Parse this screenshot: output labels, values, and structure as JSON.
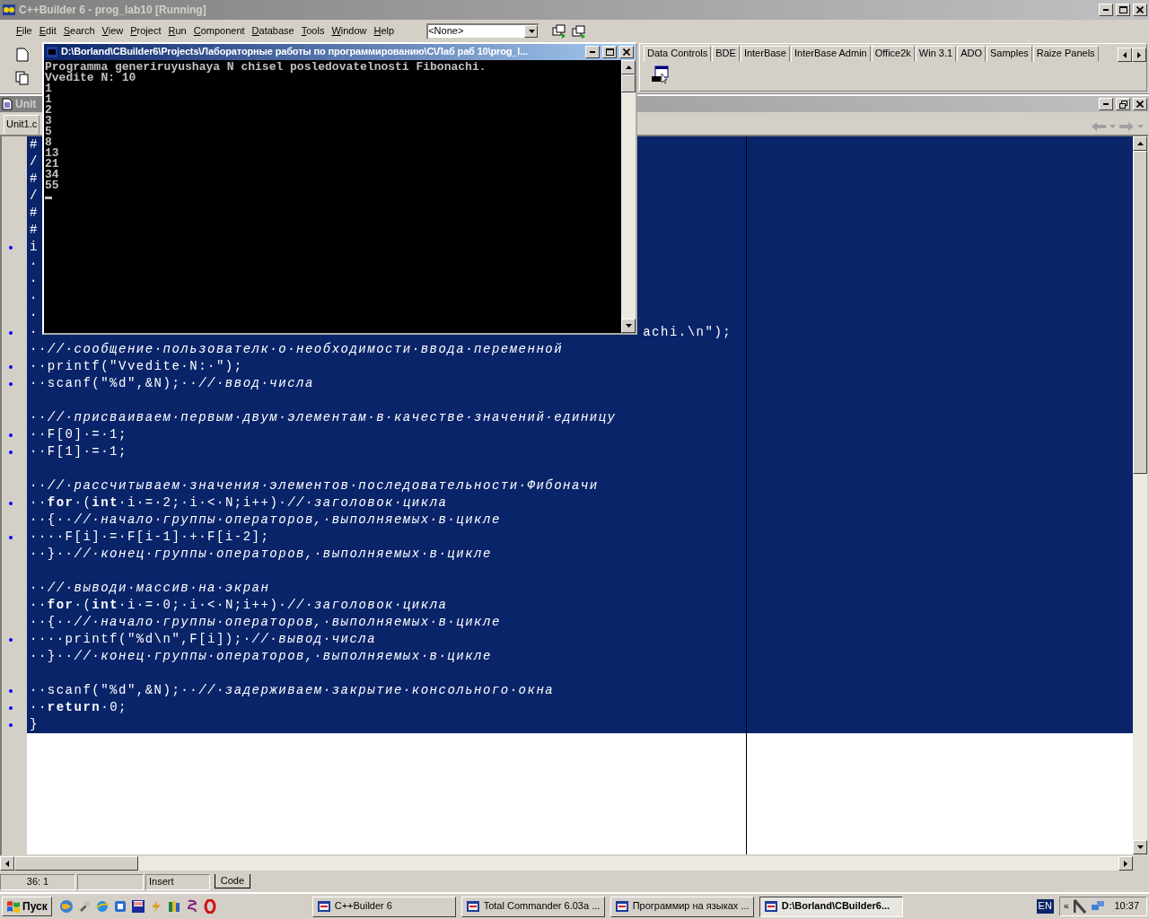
{
  "ide_window": {
    "title": "C++Builder 6 - prog_lab10 [Running]",
    "menu": [
      "File",
      "Edit",
      "Search",
      "View",
      "Project",
      "Run",
      "Component",
      "Database",
      "Tools",
      "Window",
      "Help"
    ],
    "target_combo": {
      "value": "<None>"
    },
    "palette_tabs": [
      "Data Controls",
      "BDE",
      "InterBase",
      "InterBase Admin",
      "Office2k",
      "Win 3.1",
      "ADO",
      "Samples",
      "Raize Panels"
    ]
  },
  "editor_window": {
    "title": "Unit",
    "file_tab": "Unit1.c",
    "code_lines": [
      {
        "kind": "code",
        "text": "#",
        "marker": false
      },
      {
        "kind": "code",
        "text": "/",
        "marker": false
      },
      {
        "kind": "code",
        "text": "#",
        "marker": false
      },
      {
        "kind": "code",
        "text": "/",
        "marker": false
      },
      {
        "kind": "code",
        "text": "#",
        "marker": false
      },
      {
        "kind": "code",
        "text": "#",
        "marker": false
      },
      {
        "kind": "code",
        "text": "i",
        "marker": true
      },
      {
        "kind": "code",
        "text": "·",
        "marker": false
      },
      {
        "kind": "code",
        "text": "·",
        "marker": false
      },
      {
        "kind": "code",
        "text": "·",
        "marker": false
      },
      {
        "kind": "code",
        "text": "·",
        "marker": false
      },
      {
        "kind": "code",
        "text": "·",
        "tail": "achi.\\n\");",
        "marker": true
      },
      {
        "kind": "code",
        "text": "··*//·сообщение·пользователк·о·необходимости·ввода·переменной*",
        "marker": false
      },
      {
        "kind": "code",
        "text": "··printf(\"Vvedite·N:·\");",
        "marker": true
      },
      {
        "kind": "code",
        "text": "··scanf(\"%d\",&N);··*//·ввод·числа*",
        "marker": true
      },
      {
        "kind": "blank"
      },
      {
        "kind": "code",
        "text": "··*//·присваиваем·первым·двум·элементам·в·качестве·значений·единицу*",
        "marker": false
      },
      {
        "kind": "code",
        "text": "··F[0]·=·1;",
        "marker": true
      },
      {
        "kind": "code",
        "text": "··F[1]·=·1;",
        "marker": true
      },
      {
        "kind": "blank"
      },
      {
        "kind": "code",
        "text": "··*//·рассчитываем·значения·элементов·последовательности·Фибоначи*",
        "marker": false
      },
      {
        "kind": "code",
        "text": "··**for**·(**int**·i·=·2;·i·<·N;i++)·*//·заголовок·цикла*",
        "marker": true
      },
      {
        "kind": "code",
        "text": "··{··*//·начало·группы·операторов,·выполняемых·в·цикле*",
        "marker": false
      },
      {
        "kind": "code",
        "text": "····F[i]·=·F[i-1]·+·F[i-2];",
        "marker": true
      },
      {
        "kind": "code",
        "text": "··}··*//·конец·группы·операторов,·выполняемых·в·цикле*",
        "marker": false
      },
      {
        "kind": "blank"
      },
      {
        "kind": "code",
        "text": "··*//·выводи·массив·на·экран*",
        "marker": false
      },
      {
        "kind": "code",
        "text": "··**for**·(**int**·i·=·0;·i·<·N;i++)·*//·заголовок·цикла*",
        "marker": false
      },
      {
        "kind": "code",
        "text": "··{··*//·начало·группы·операторов,·выполняемых·в·цикле*",
        "marker": false
      },
      {
        "kind": "code",
        "text": "····printf(\"%d\\n\",F[i]);·*//·вывод·числа*",
        "marker": true
      },
      {
        "kind": "code",
        "text": "··}··*//·конец·группы·операторов,·выполняемых·в·цикле*",
        "marker": false
      },
      {
        "kind": "blank"
      },
      {
        "kind": "code",
        "text": "··scanf(\"%d\",&N);··*//·задерживаем·закрытие·консольного·окна*",
        "marker": true
      },
      {
        "kind": "code",
        "text": "··**return**·0;",
        "marker": true
      },
      {
        "kind": "code",
        "text": "}",
        "marker": true
      }
    ]
  },
  "console_window": {
    "title": "D:\\Borland\\CBuilder6\\Projects\\Лабораторные работы по программированию\\C\\Лаб раб 10\\prog_l...",
    "lines": [
      "Programma generiruyushaya N chisel posledovatelnosti Fibonachi.",
      "Vvedite N: 10",
      "1",
      "1",
      "2",
      "3",
      "5",
      "8",
      "13",
      "21",
      "34",
      "55"
    ]
  },
  "status_bar": {
    "position": "36:  1",
    "mode": "Insert",
    "view_tab": "Code"
  },
  "taskbar": {
    "start_button": "Пуск",
    "tasks": [
      {
        "label": "C++Builder 6",
        "selected": false
      },
      {
        "label": "Total Commander 6.03a ...",
        "selected": false
      },
      {
        "label": "Программир на языках ...",
        "selected": false
      },
      {
        "label": "D:\\Borland\\CBuilder6...",
        "selected": true
      }
    ],
    "language": "EN",
    "tray_chevron": "«",
    "clock": "10:37"
  }
}
